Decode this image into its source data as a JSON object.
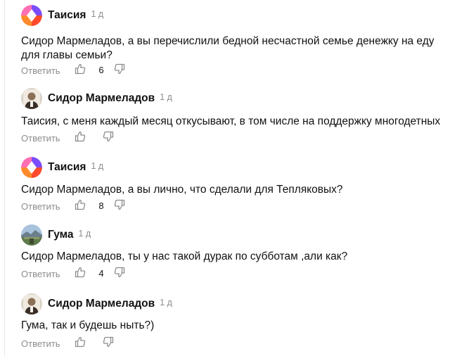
{
  "comments": [
    {
      "author": "Таисия",
      "time": "1 д",
      "avatar": "abstract-avatar",
      "lines": [
        "Сидор Мармеладов, а вы перечислили бедной несчастной семье денежку на еду",
        "для главы семьи?"
      ],
      "reply_label": "Ответить",
      "likes": "6"
    },
    {
      "author": "Сидор Мармеладов",
      "time": "1 д",
      "avatar": "photo-avatar",
      "lines": [
        "Таисия, с меня каждый месяц откусывают, в том числе на поддержку многодетных"
      ],
      "reply_label": "Ответить",
      "likes": ""
    },
    {
      "author": "Таисия",
      "time": "1 д",
      "avatar": "abstract-avatar",
      "lines": [
        "Сидор Мармеладов, а вы лично, что сделали для Тепляковых?"
      ],
      "reply_label": "Ответить",
      "likes": "8"
    },
    {
      "author": "Гума",
      "time": "1 д",
      "avatar": "landscape-avatar",
      "lines": [
        "Сидор Мармеладов, ты у нас такой дурак по субботам ,али как?"
      ],
      "reply_label": "Ответить",
      "likes": "4"
    },
    {
      "author": "Сидор Мармеладов",
      "time": "1 д",
      "avatar": "photo-avatar",
      "lines": [
        "Гума, так и будешь ныть?)"
      ],
      "reply_label": "Ответить",
      "likes": ""
    }
  ],
  "colors": {
    "muted": "#8c8c8c",
    "text": "#111111",
    "abstract_purple": "#7b4dff",
    "abstract_red": "#ff4b2b",
    "abstract_pink": "#ff6fb5"
  }
}
